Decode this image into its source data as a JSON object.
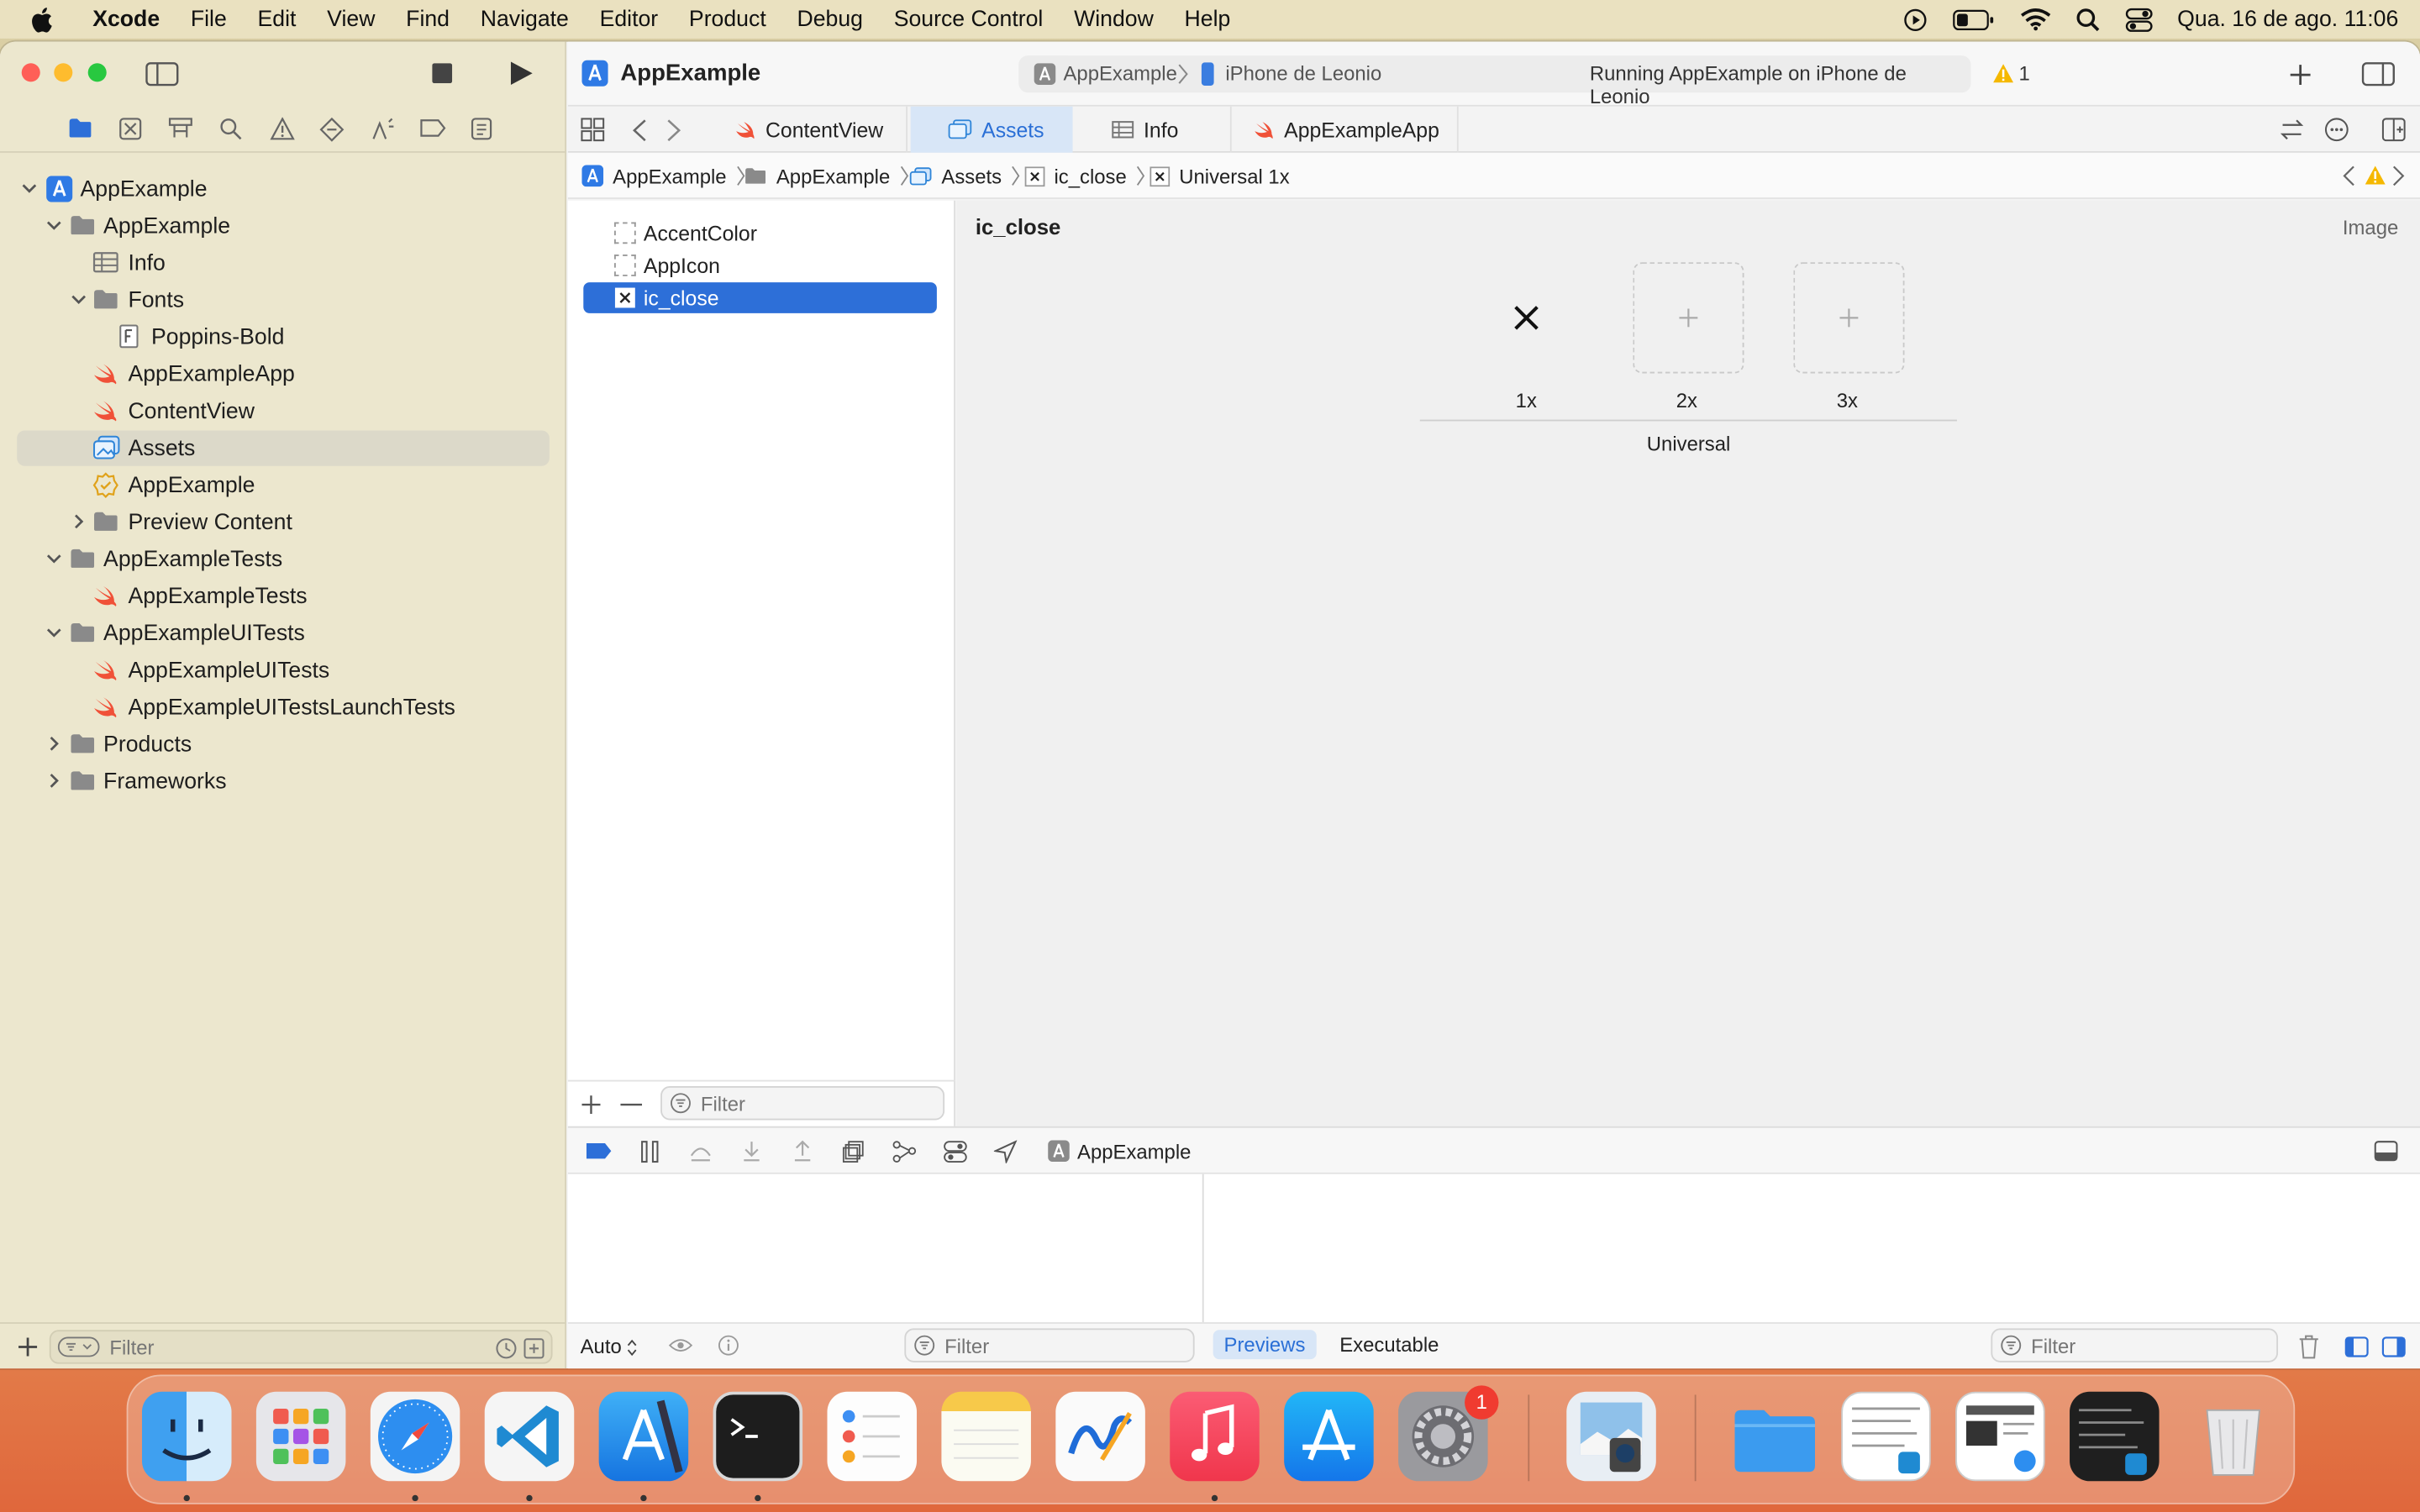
{
  "menubar": {
    "app": "Xcode",
    "items": [
      "File",
      "Edit",
      "View",
      "Find",
      "Navigate",
      "Editor",
      "Product",
      "Debug",
      "Source Control",
      "Window",
      "Help"
    ],
    "clock": "Qua. 16 de ago.  11:06"
  },
  "toolbar": {
    "project_title": "AppExample",
    "scheme": "AppExample",
    "device": "iPhone de Leonio",
    "status": "Running AppExample on iPhone de Leonio",
    "warning_count": "1"
  },
  "navigator": {
    "items": [
      {
        "label": "AppExample",
        "icon": "project-icon"
      },
      {
        "label": "AppExample",
        "icon": "folder-icon"
      },
      {
        "label": "Info",
        "icon": "table-icon"
      },
      {
        "label": "Fonts",
        "icon": "folder-icon"
      },
      {
        "label": "Poppins-Bold",
        "icon": "font-file-icon"
      },
      {
        "label": "AppExampleApp",
        "icon": "swift-icon"
      },
      {
        "label": "ContentView",
        "icon": "swift-icon"
      },
      {
        "label": "Assets",
        "icon": "assets-icon"
      },
      {
        "label": "AppExample",
        "icon": "entitlements-icon"
      },
      {
        "label": "Preview Content",
        "icon": "folder-icon"
      },
      {
        "label": "AppExampleTests",
        "icon": "folder-icon"
      },
      {
        "label": "AppExampleTests",
        "icon": "swift-icon"
      },
      {
        "label": "AppExampleUITests",
        "icon": "folder-icon"
      },
      {
        "label": "AppExampleUITests",
        "icon": "swift-icon"
      },
      {
        "label": "AppExampleUITestsLaunchTests",
        "icon": "swift-icon"
      },
      {
        "label": "Products",
        "icon": "folder-icon"
      },
      {
        "label": "Frameworks",
        "icon": "folder-icon"
      }
    ],
    "filter_placeholder": "Filter"
  },
  "tabs": [
    "ContentView",
    "Assets",
    "Info",
    "AppExampleApp"
  ],
  "jumpbar": [
    "AppExample",
    "AppExample",
    "Assets",
    "ic_close",
    "Universal 1x"
  ],
  "assets": {
    "items": [
      "AccentColor",
      "AppIcon",
      "ic_close"
    ],
    "filter_placeholder": "Filter"
  },
  "asset_detail": {
    "name": "ic_close",
    "type": "Image",
    "slots": [
      "1x",
      "2x",
      "3x"
    ],
    "group": "Universal"
  },
  "debug": {
    "target": "AppExample",
    "auto": "Auto",
    "filter_placeholder": "Filter",
    "previews": "Previews",
    "executable": "Executable"
  },
  "dock": {
    "settings_badge": "1"
  },
  "colors": {
    "accent": "#2d6fd8",
    "swift": "#f05138",
    "warning": "#f5b800"
  }
}
